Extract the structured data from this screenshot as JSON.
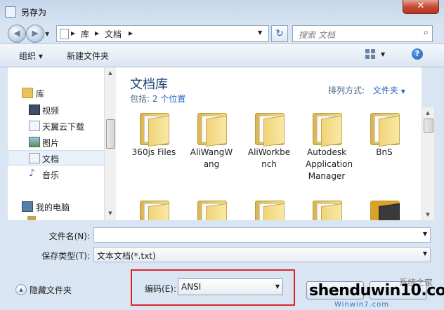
{
  "window": {
    "title": "另存为",
    "close_label": "✕"
  },
  "nav": {
    "back_icon": "back-arrow-icon",
    "forward_icon": "forward-arrow-icon",
    "breadcrumb": [
      "库",
      "文档"
    ],
    "search_placeholder": "搜索 文档"
  },
  "toolbar": {
    "organize": "组织 ▾",
    "new_folder": "新建文件夹",
    "help": "?"
  },
  "sidebar": {
    "items": [
      {
        "label": "库",
        "icon": "library-icon"
      },
      {
        "label": "视频",
        "icon": "video-icon"
      },
      {
        "label": "天翼云下载",
        "icon": "document-icon"
      },
      {
        "label": "图片",
        "icon": "picture-icon"
      },
      {
        "label": "文档",
        "icon": "document-icon",
        "selected": true
      },
      {
        "label": "音乐",
        "icon": "music-icon"
      },
      {
        "label": "我的电脑",
        "icon": "computer-icon"
      }
    ]
  },
  "library": {
    "title": "文档库",
    "includes_label": "包括:",
    "includes_link": "2 个位置",
    "arrange_label": "排列方式:",
    "arrange_value": "文件夹"
  },
  "folders": [
    "360js Files",
    "AliWangWang",
    "AliWorkbench",
    "Autodesk Application Manager",
    "BnS"
  ],
  "form": {
    "filename_label": "文件名(N):",
    "filename_value": "",
    "filetype_label": "保存类型(T):",
    "filetype_value": "文本文档(*.txt)",
    "encoding_label": "编码(E):",
    "encoding_value": "ANSI",
    "hide_folders": "隐藏文件夹"
  },
  "watermark": {
    "main": "shenduwin10.com",
    "sub": "Winwin7.com",
    "extra": "系统之家"
  },
  "colors": {
    "highlight_box": "#e0242c",
    "title_blue": "#1d3f73",
    "link_blue": "#2b67c0"
  }
}
